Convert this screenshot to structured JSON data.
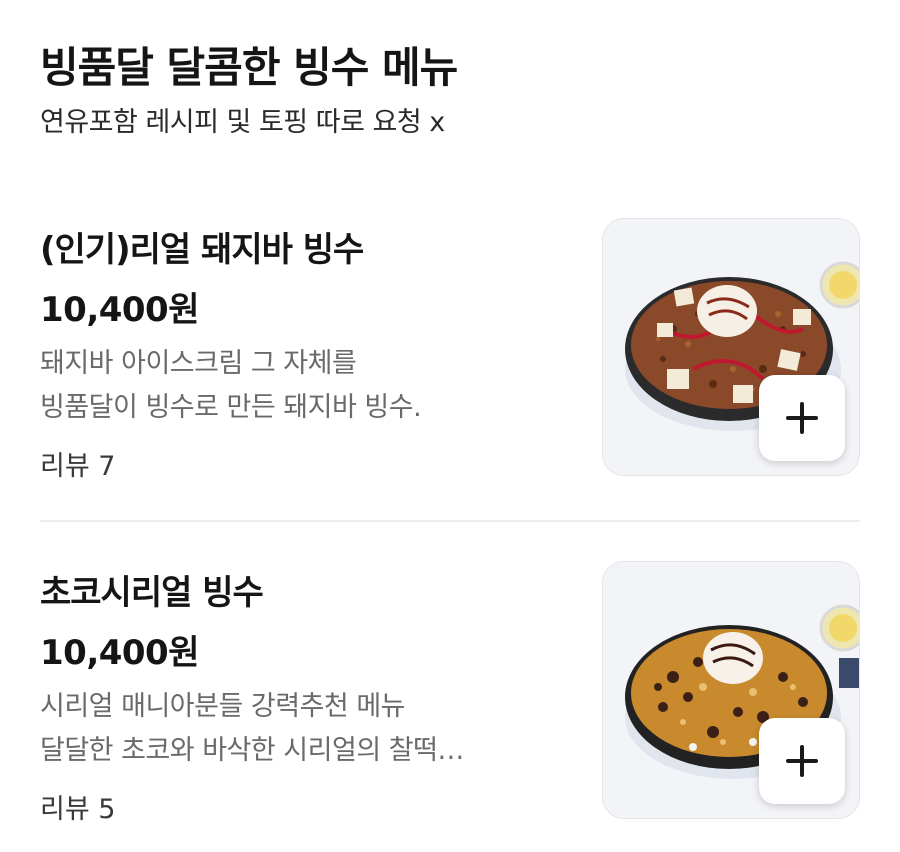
{
  "section": {
    "title": "빙품달 달콤한 빙수 메뉴",
    "subtitle": "연유포함 레시피 및 토핑 따로 요청 x"
  },
  "menu_items": [
    {
      "name": "(인기)리얼 돼지바 빙수",
      "price": "10,400원",
      "description_lines": [
        "돼지바 아이스크림 그 자체를",
        "빙품달이 빙수로 만든 돼지바 빙수."
      ],
      "review": "리뷰 7",
      "image_icon": "pork-bar-bingsu-photo",
      "add_icon": "plus-icon"
    },
    {
      "name": "초코시리얼 빙수",
      "price": "10,400원",
      "description_lines": [
        "시리얼 매니아분들 강력추천 메뉴",
        "달달한 초코와 바삭한 시리얼의 찰떡…"
      ],
      "review": "리뷰 5",
      "image_icon": "choco-cereal-bingsu-photo",
      "add_icon": "plus-icon"
    }
  ],
  "colors": {
    "text_primary": "#151515",
    "text_secondary": "#6a6a6a",
    "divider": "#ececec"
  }
}
